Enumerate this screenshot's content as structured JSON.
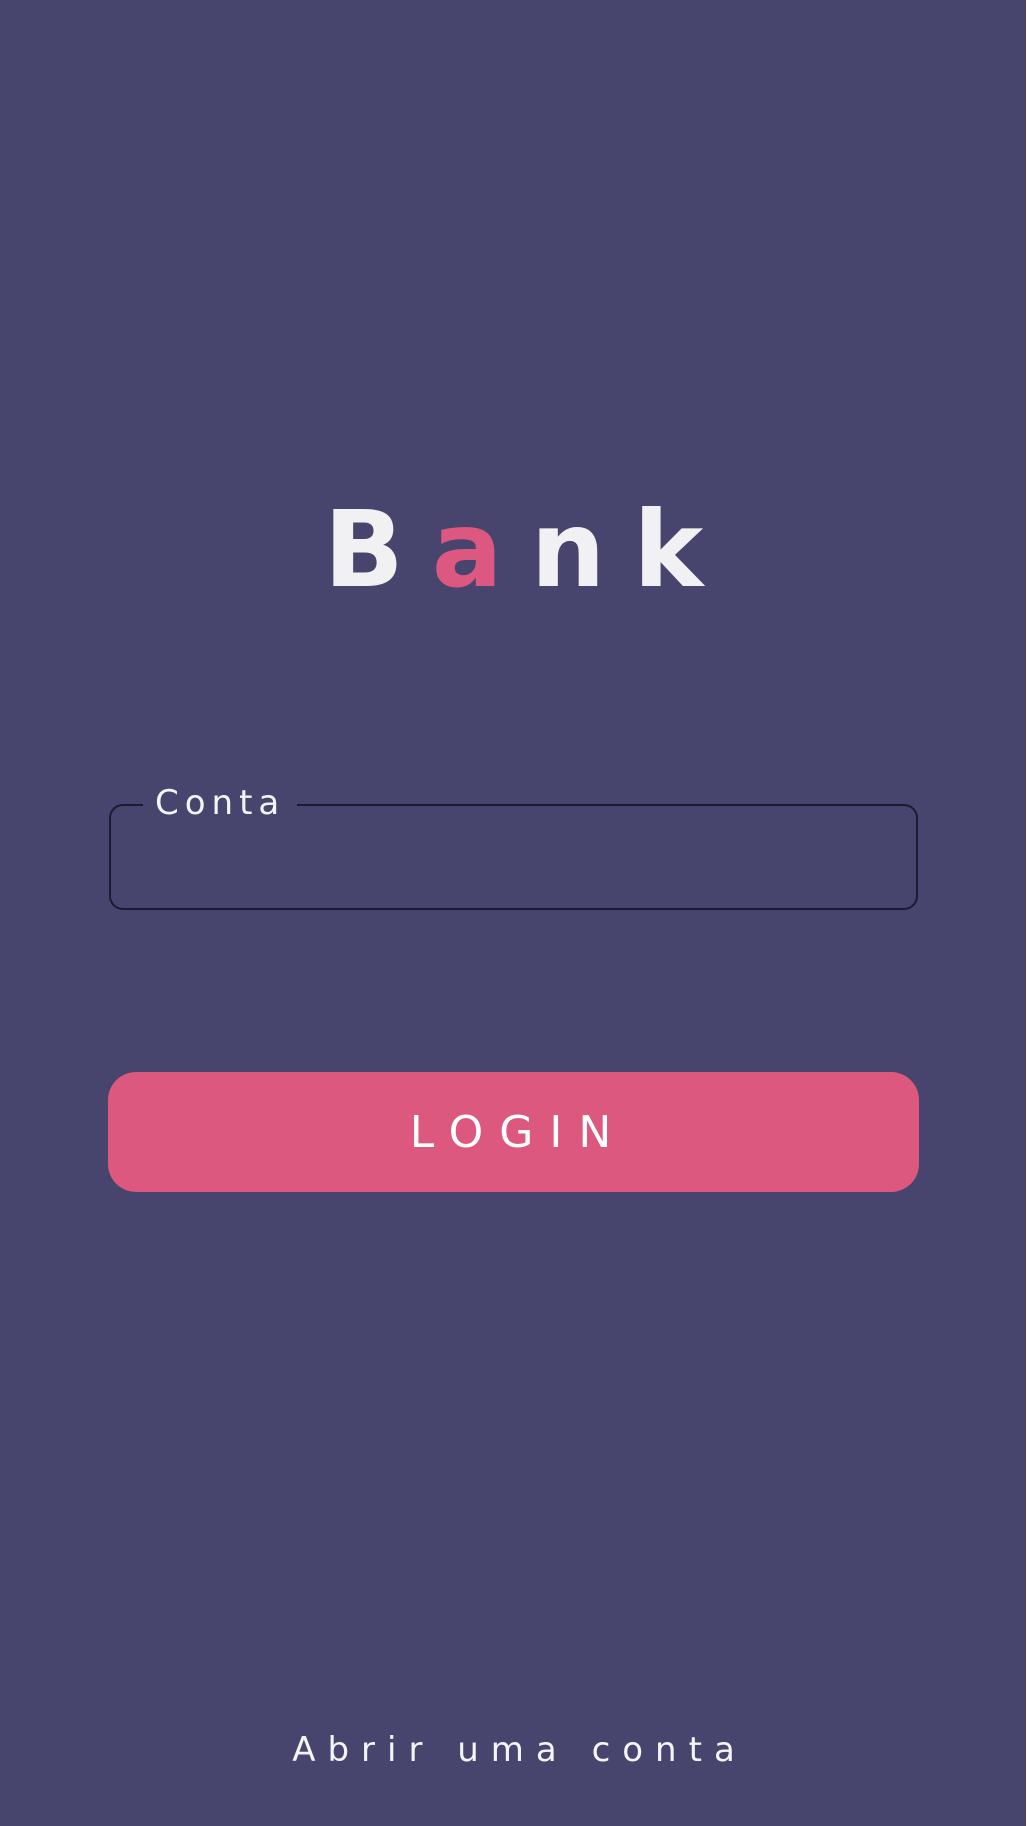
{
  "app": {
    "logo": {
      "part1": "B",
      "part2": "a",
      "part3": "nk"
    },
    "colors": {
      "background": "#47456e",
      "accent": "#dc587e",
      "text": "#f4f4f6"
    }
  },
  "login_form": {
    "account_label": "Conta",
    "account_value": "",
    "login_button": "LOGIN"
  },
  "footer": {
    "open_account_link": "Abrir uma conta"
  }
}
